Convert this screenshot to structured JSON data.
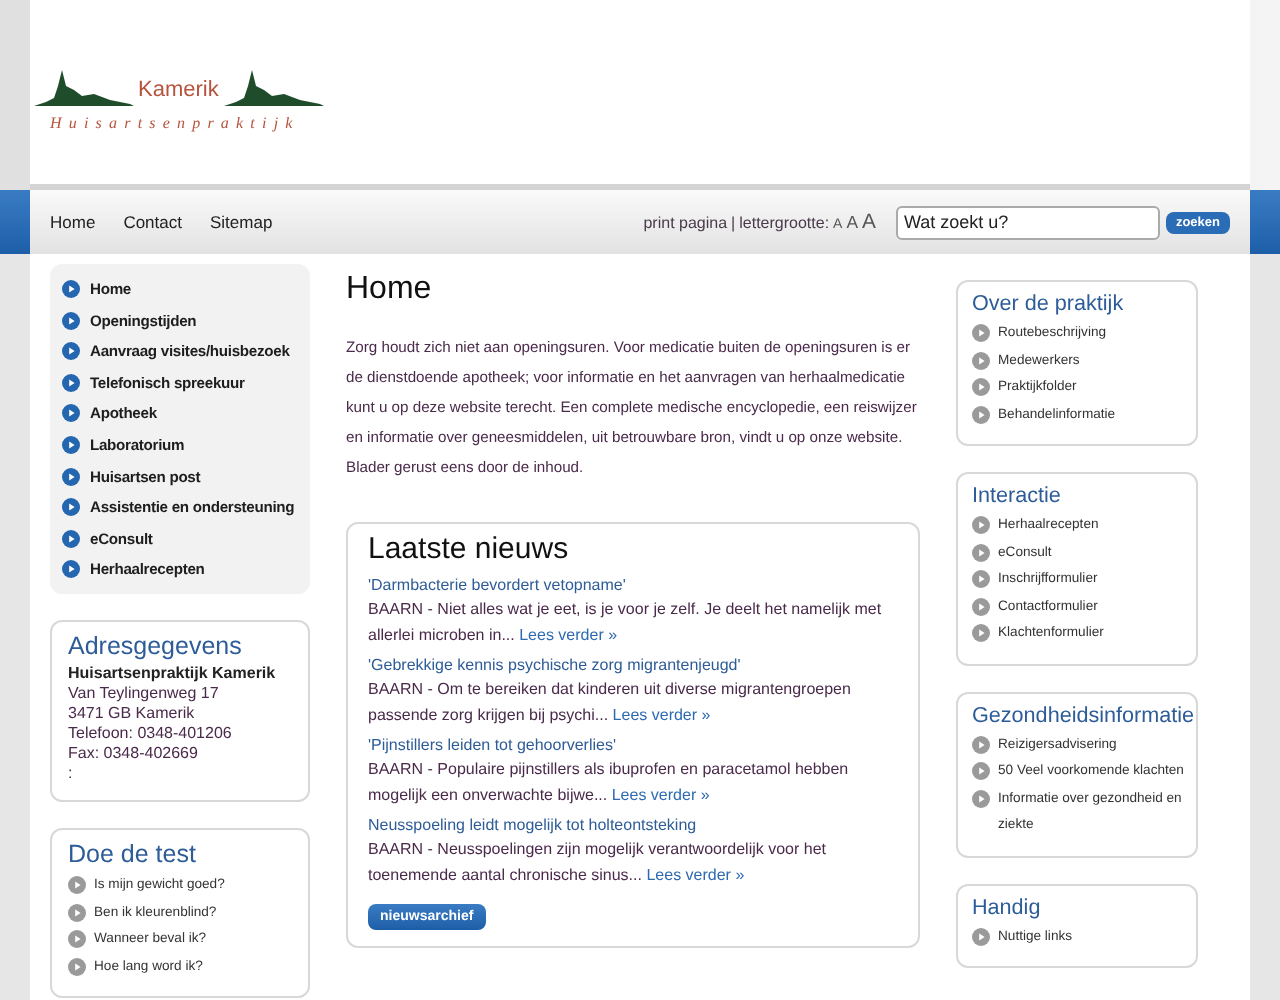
{
  "logo": {
    "name": "Kamerik",
    "tagline": "Huisartsenpraktijk"
  },
  "nav": [
    "Home",
    "Contact",
    "Sitemap"
  ],
  "tools": {
    "print": "print pagina",
    "separator": "|",
    "size_label": "lettergrootte:",
    "sizes": [
      "A",
      "A",
      "A"
    ]
  },
  "search": {
    "placeholder": "Wat zoekt u?",
    "button": "zoeken"
  },
  "menu": [
    "Home",
    "Openingstijden",
    "Aanvraag visites/huisbezoek",
    "Telefonisch spreekuur",
    "Apotheek",
    "Laboratorium",
    "Huisartsen post",
    "Assistentie en ondersteuning",
    "eConsult",
    "Herhaalrecepten"
  ],
  "address": {
    "title": "Adresgegevens",
    "lines": [
      {
        "kind": "name",
        "text": "Huisartsenpraktijk Kamerik"
      },
      {
        "kind": "line",
        "text": "Van Teylingenweg 17"
      },
      {
        "kind": "line",
        "text": "3471 GB Kamerik"
      },
      {
        "kind": "line",
        "text": "Telefoon: 0348-401206"
      },
      {
        "kind": "line",
        "text": "Fax: 0348-402669"
      },
      {
        "kind": "line",
        "text": ":"
      }
    ]
  },
  "test": {
    "title": "Doe de test",
    "items": [
      "Is mijn gewicht goed?",
      "Ben ik kleurenblind?",
      "Wanneer beval ik?",
      "Hoe lang word ik?"
    ]
  },
  "page": {
    "title": "Home",
    "intro": "Zorg houdt zich niet aan openingsuren. Voor medicatie buiten de openingsuren is er de dienstdoende apotheek; voor informatie en het aanvragen van herhaalmedicatie kunt u op deze website terecht. Een complete medische encyclopedie, een reiswijzer en informatie over geneesmiddelen, uit betrouwbare bron, vindt u op onze website. Blader gerust eens door de inhoud."
  },
  "news": {
    "title": "Laatste nieuws",
    "items": [
      {
        "title": "'Darmbacterie bevordert vetopname'",
        "text": "BAARN - Niet alles wat je eet, is je voor je zelf. Je deelt het namelijk met allerlei microben in...",
        "more": "Lees verder »"
      },
      {
        "title": "'Gebrekkige kennis psychische zorg migrantenjeugd'",
        "text": "BAARN - Om te bereiken dat kinderen uit diverse migrantengroepen passende zorg krijgen bij psychi...",
        "more": "Lees verder »"
      },
      {
        "title": "'Pijnstillers leiden tot gehoorverlies'",
        "text": "BAARN - Populaire pijnstillers als ibuprofen en paracetamol hebben mogelijk een onverwachte bijwe...",
        "more": "Lees verder »"
      },
      {
        "title": "Neusspoeling leidt mogelijk tot holteontsteking",
        "text": "BAARN - Neusspoelingen zijn mogelijk verantwoordelijk voor het toenemende aantal chronische sinus...",
        "more": "Lees verder »"
      }
    ],
    "archive": "nieuwsarchief"
  },
  "boxes": [
    {
      "title": "Over de praktijk",
      "items": [
        "Routebeschrijving",
        "Medewerkers",
        "Praktijkfolder",
        "Behandelinformatie"
      ]
    },
    {
      "title": "Interactie",
      "items": [
        "Herhaalrecepten",
        "eConsult",
        "Inschrijfformulier",
        "Contactformulier",
        "Klachtenformulier"
      ]
    },
    {
      "title": "Gezondheidsinformatie",
      "items": [
        "Reizigersadvisering",
        "50 Veel voorkomende klachten",
        "Informatie over gezondheid en ziekte"
      ]
    },
    {
      "title": "Handig",
      "items": [
        "Nuttige links"
      ]
    }
  ]
}
